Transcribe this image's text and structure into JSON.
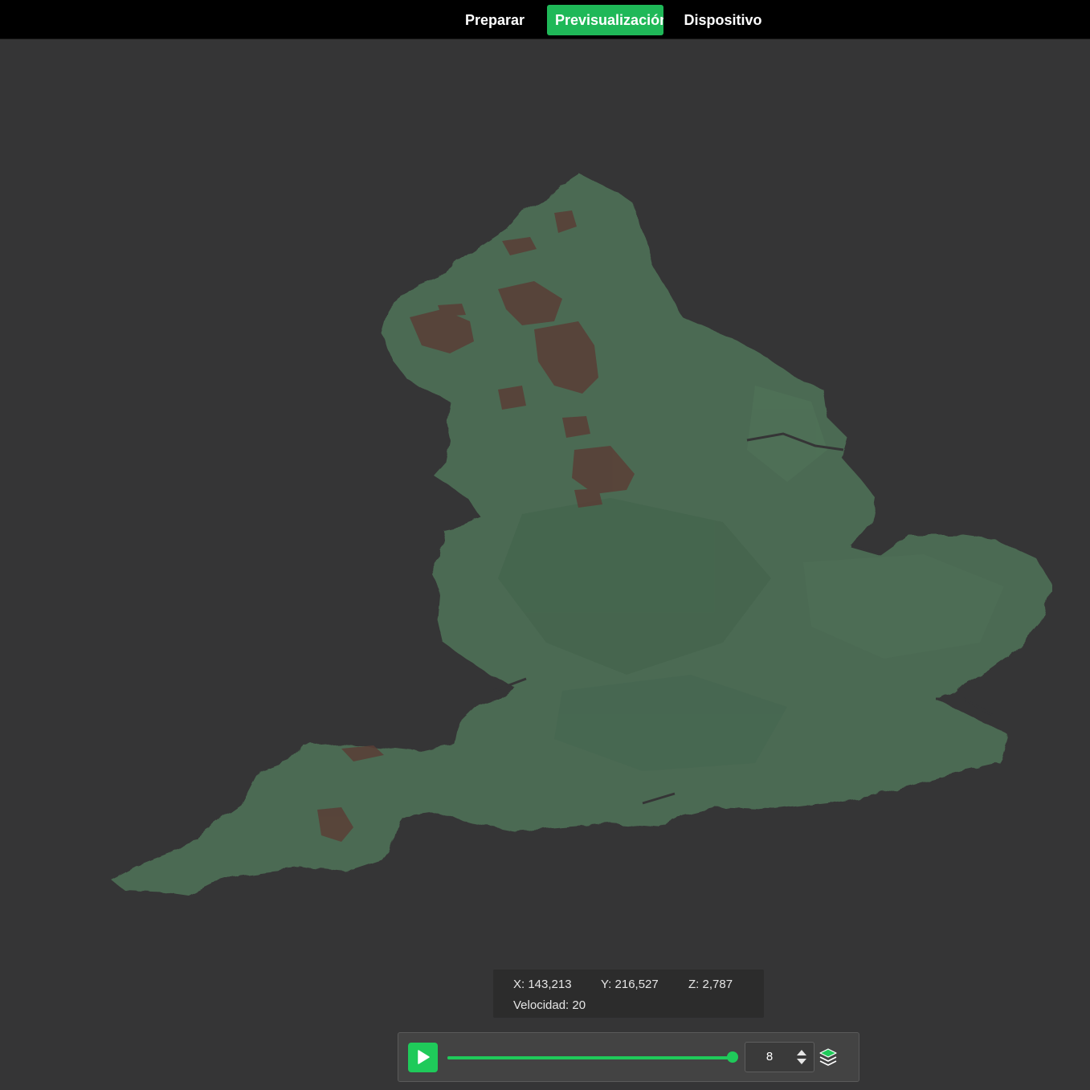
{
  "header": {
    "tabs": [
      {
        "label": "Preparar",
        "active": false
      },
      {
        "label": "Previsualización",
        "active": true
      },
      {
        "label": "Dispositivo",
        "active": false
      }
    ],
    "accent_color": "#1fb858"
  },
  "viewport": {
    "background_color": "#353536",
    "model_colors": {
      "lowland": "#4b6a52",
      "midland": "#3f5f48",
      "highland": "#5a3e36"
    }
  },
  "coordinates": {
    "x": "X: 143,213",
    "y": "Y: 216,527",
    "z": "Z: 2,787",
    "speed_label": "Velocidad:",
    "speed_value": "20"
  },
  "playback": {
    "play_icon": "play-icon",
    "slider_fraction": 1.0,
    "layer_value": "8",
    "layers_icon": "layers-icon",
    "accent_color": "#1fca5a"
  }
}
